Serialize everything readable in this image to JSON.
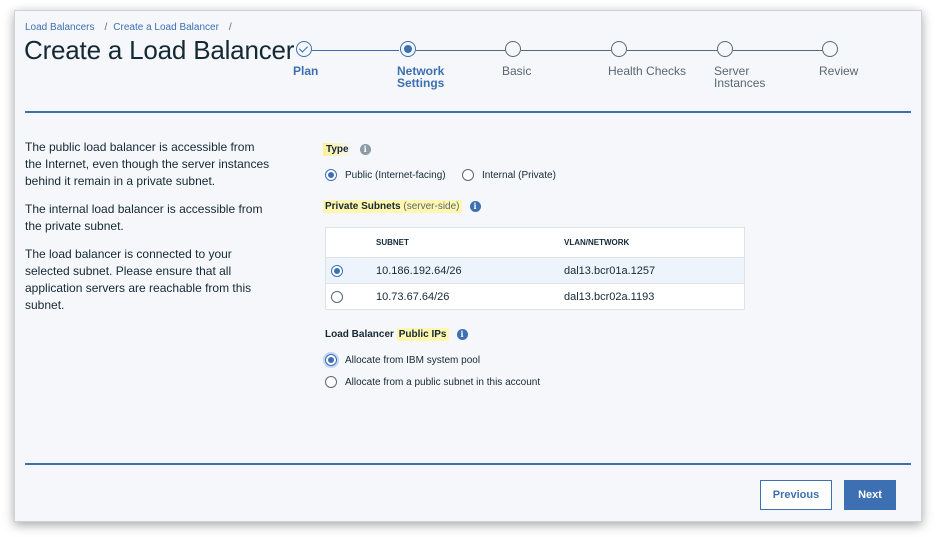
{
  "breadcrumb": {
    "items": [
      "Load Balancers",
      "Create a Load Balancer"
    ],
    "separator": "/"
  },
  "page_title": "Create a Load Balancer",
  "stepper": {
    "steps": [
      {
        "label": "Plan",
        "state": "done"
      },
      {
        "label": "Network Settings",
        "state": "current"
      },
      {
        "label": "Basic",
        "state": "todo"
      },
      {
        "label": "Health Checks",
        "state": "todo"
      },
      {
        "label": "Server Instances",
        "state": "todo"
      },
      {
        "label": "Review",
        "state": "todo"
      }
    ]
  },
  "help": {
    "paragraphs": [
      "The public load balancer is accessible from the Internet, even though the server instances behind it remain in a private subnet.",
      "The internal load balancer is accessible from the private subnet.",
      "The load balancer is connected to your selected subnet. Please ensure that all application servers are reachable from this subnet."
    ]
  },
  "type_section": {
    "label": "Type",
    "options": [
      {
        "label": "Public (Internet-facing)",
        "checked": true
      },
      {
        "label": "Internal (Private)",
        "checked": false
      }
    ]
  },
  "subnets_section": {
    "label": "Private Subnets",
    "label_suffix": "(server-side)",
    "columns": [
      "SUBNET",
      "VLAN/NETWORK"
    ],
    "rows": [
      {
        "subnet": "10.186.192.64/26",
        "vlan": "dal13.bcr01a.1257",
        "checked": true
      },
      {
        "subnet": "10.73.67.64/26",
        "vlan": "dal13.bcr02a.1193",
        "checked": false
      }
    ]
  },
  "public_ips_section": {
    "label_prefix": "Load Balancer ",
    "label_highlight": "Public IPs",
    "options": [
      {
        "label": "Allocate from IBM system pool",
        "checked": true
      },
      {
        "label": "Allocate from a public subnet in this account",
        "checked": false
      }
    ]
  },
  "buttons": {
    "previous": "Previous",
    "next": "Next"
  },
  "colors": {
    "accent": "#3d70b2",
    "highlight": "#fff6b0",
    "text": "#152935"
  },
  "icons": {
    "info": "info-icon",
    "check": "check-icon"
  }
}
